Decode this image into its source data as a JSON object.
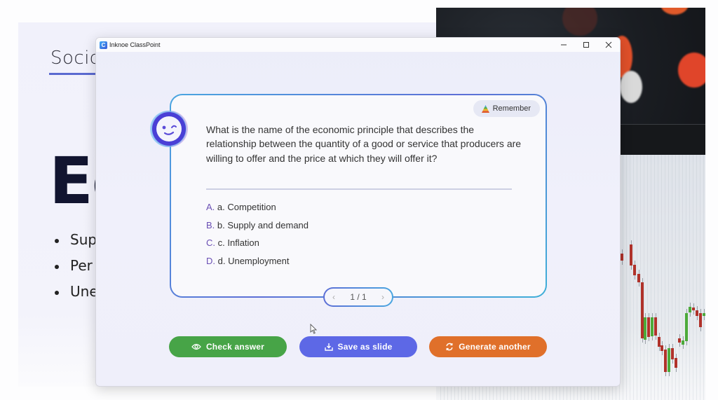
{
  "background_slide": {
    "title_partial": "Socic",
    "big_heading_partial": "Ec",
    "bullets": [
      "Sup",
      "Per",
      "Une"
    ]
  },
  "window": {
    "title": "Inknoe ClassPoint",
    "app_icon_letter": "C",
    "controls": {
      "minimize": "–",
      "maximize": "☐",
      "close": "✕"
    }
  },
  "card": {
    "bloom_level_badge": "Remember",
    "question": "What is the name of the economic principle that describes the relationship between the quantity of a good or service that producers are willing to offer and the price at which they will offer it?",
    "options": [
      {
        "letter": "A.",
        "text": "a. Competition"
      },
      {
        "letter": "B.",
        "text": "b. Supply and demand"
      },
      {
        "letter": "C.",
        "text": "c. Inflation"
      },
      {
        "letter": "D.",
        "text": "d. Unemployment"
      }
    ],
    "pager": {
      "prev": "‹",
      "label": "1 / 1",
      "next": "›"
    }
  },
  "actions": {
    "check_answer": "Check answer",
    "save_as_slide": "Save as slide",
    "generate_another": "Generate another"
  },
  "colors": {
    "check_answer": "#47a447",
    "save_as_slide": "#5d68e6",
    "generate_another": "#e0702a",
    "option_letter": "#6a4fb4",
    "card_border": "#4aa6e0"
  }
}
